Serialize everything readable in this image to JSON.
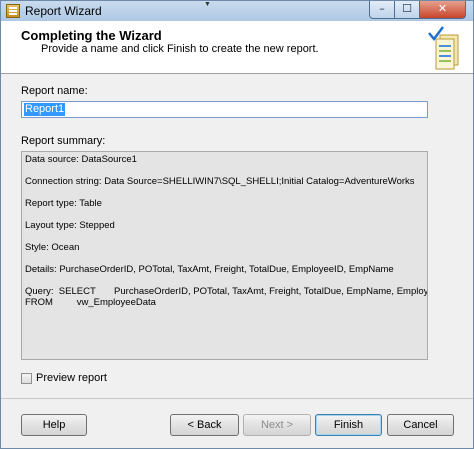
{
  "window": {
    "title": "Report Wizard",
    "minimize_glyph": "–",
    "maximize_glyph": "☐",
    "close_glyph": "✕"
  },
  "header": {
    "title": "Completing the Wizard",
    "description": "Provide a name and click Finish to create the new report.",
    "art_icon": "wizard-report-icon"
  },
  "report_name": {
    "label": "Report name:",
    "value": "Report1"
  },
  "report_summary": {
    "label": "Report summary:",
    "lines": [
      "Data source: DataSource1",
      "",
      "Connection string: Data Source=SHELLIWIN7\\SQL_SHELLI;Initial Catalog=AdventureWorks",
      "",
      "Report type: Table",
      "",
      "Layout type: Stepped",
      "",
      "Style: Ocean",
      "",
      "Details: PurchaseOrderID, POTotal, TaxAmt, Freight, TotalDue, EmployeeID, EmpName",
      "",
      "Query:  SELECT       PurchaseOrderID, POTotal, TaxAmt, Freight, TotalDue, EmpName, EmployeeID",
      "FROM         vw_EmployeeData"
    ]
  },
  "preview": {
    "label": "Preview report",
    "checked": false
  },
  "buttons": {
    "help": "Help",
    "back": "< Back",
    "next": "Next >",
    "finish": "Finish",
    "cancel": "Cancel"
  },
  "colors": {
    "accent_selection": "#3399ff",
    "checkmark": "#1f6fd1",
    "close_button": "#c8442c"
  }
}
